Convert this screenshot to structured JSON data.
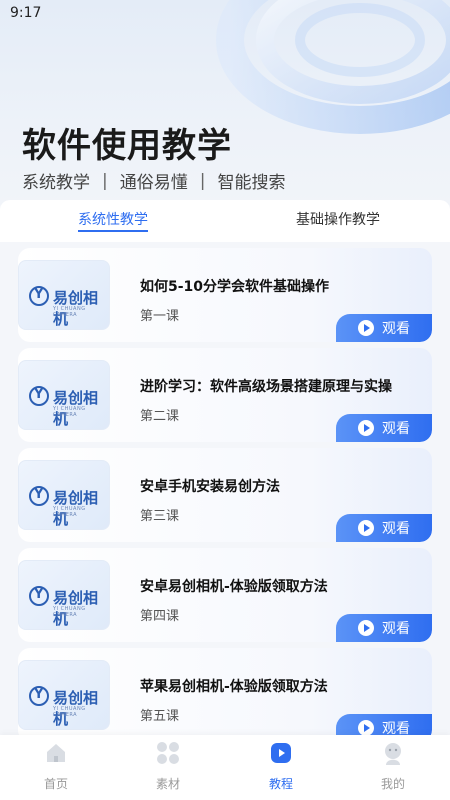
{
  "status_bar": {
    "time": "9:17"
  },
  "header": {
    "title": "软件使用教学",
    "subtitle": [
      "系统教学",
      "通俗易懂",
      "智能搜索"
    ],
    "separator": "|"
  },
  "tabs": [
    {
      "label": "系统性教学",
      "active": true
    },
    {
      "label": "基础操作教学",
      "active": false
    }
  ],
  "brand": {
    "logo_text": "易创相机",
    "logo_sub": "YI CHUANG CAMERA"
  },
  "lessons": [
    {
      "title": "如何5-10分学会软件基础操作",
      "lesson": "第一课",
      "button": "观看"
    },
    {
      "title": "进阶学习：软件高级场景搭建原理与实操",
      "lesson": "第二课",
      "button": "观看"
    },
    {
      "title": "安卓手机安装易创方法",
      "lesson": "第三课",
      "button": "观看"
    },
    {
      "title": "安卓易创相机-体验版领取方法",
      "lesson": "第四课",
      "button": "观看"
    },
    {
      "title": "苹果易创相机-体验版领取方法",
      "lesson": "第五课",
      "button": "观看"
    }
  ],
  "bottom_nav": [
    {
      "label": "首页",
      "icon": "home-icon",
      "active": false
    },
    {
      "label": "素材",
      "icon": "grid-icon",
      "active": false
    },
    {
      "label": "教程",
      "icon": "play-icon",
      "active": true
    },
    {
      "label": "我的",
      "icon": "user-icon",
      "active": false
    }
  ],
  "colors": {
    "accent": "#2f6ef0",
    "inactive": "#999999"
  }
}
